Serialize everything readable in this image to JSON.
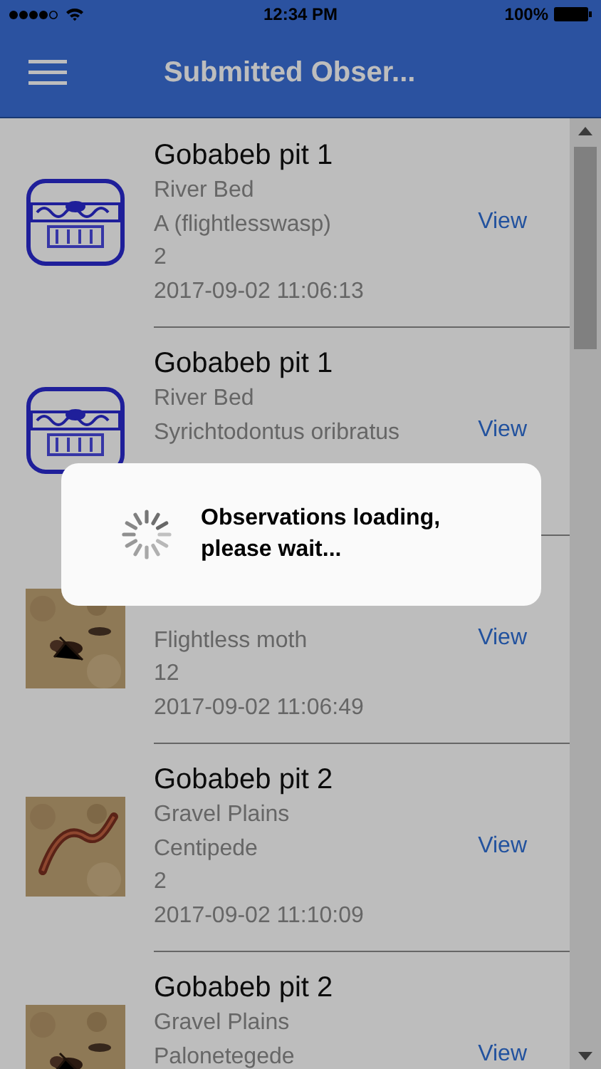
{
  "status_bar": {
    "time": "12:34 PM",
    "battery": "100%"
  },
  "header": {
    "title": "Submitted Obser..."
  },
  "observations": [
    {
      "kind": "logo",
      "title": "Gobabeb pit 1",
      "lines": [
        "River Bed",
        "A (flightlesswasp)",
        "2",
        "2017-09-02 11:06:13"
      ],
      "action": "View"
    },
    {
      "kind": "logo",
      "title": "Gobabeb pit 1",
      "lines": [
        "River Bed",
        "Syrichtodontus oribratus"
      ],
      "action": "View"
    },
    {
      "kind": "picture",
      "lines": [
        "Flightless moth",
        "12",
        "2017-09-02 11:06:49"
      ],
      "action": "View"
    },
    {
      "kind": "picture",
      "title": "Gobabeb pit 2",
      "lines": [
        "Gravel Plains",
        "Centipede",
        "2",
        "2017-09-02 11:10:09"
      ],
      "action": "View"
    },
    {
      "kind": "picture",
      "title": "Gobabeb pit 2",
      "lines": [
        "Gravel Plains",
        "Palonetegede"
      ],
      "action": "View"
    }
  ],
  "dialog": {
    "message": "Observations loading, please wait..."
  }
}
